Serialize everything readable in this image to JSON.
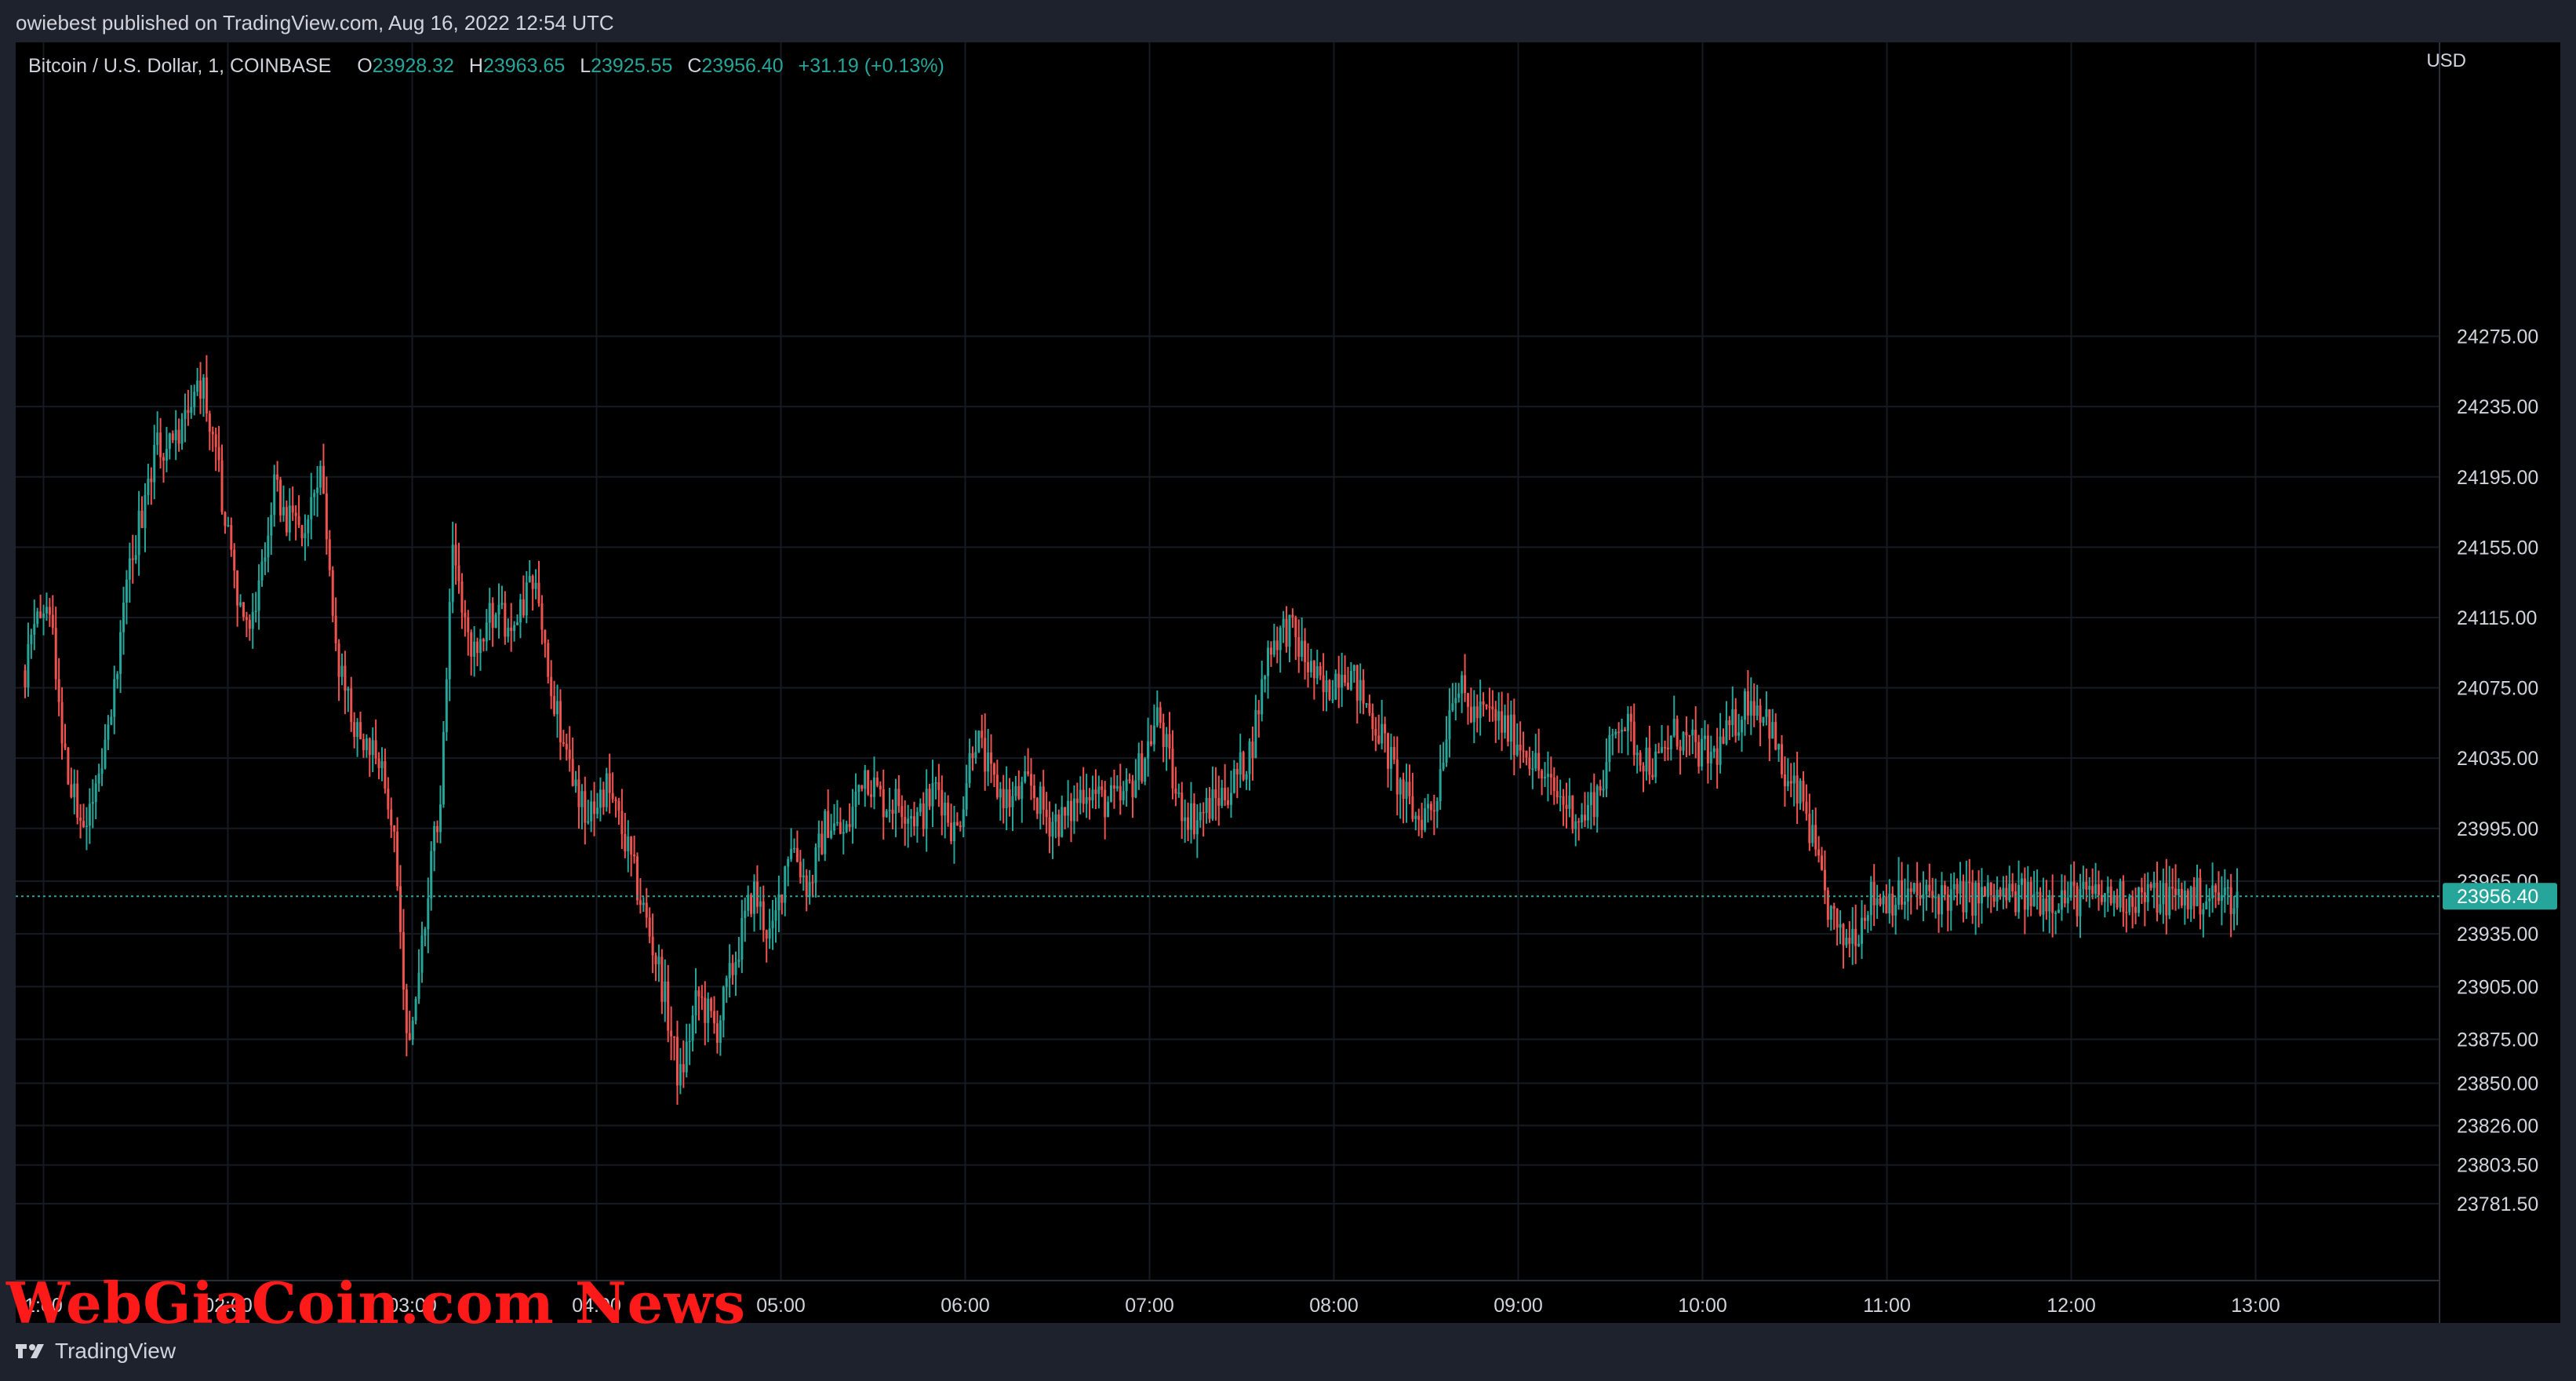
{
  "header": {
    "published_line": "owiebest published on TradingView.com, Aug 16, 2022 12:54 UTC"
  },
  "legend": {
    "symbol": "Bitcoin / U.S. Dollar, 1, COINBASE",
    "open_label": "O",
    "open": "23928.32",
    "high_label": "H",
    "high": "23963.65",
    "low_label": "L",
    "low": "23925.55",
    "close_label": "C",
    "close": "23956.40",
    "change": "+31.19 (+0.13%)"
  },
  "footer": {
    "brand": "TradingView",
    "watermark": "WebGiaCoin.com News"
  },
  "colors": {
    "up": "#26a69a",
    "down": "#ef5350",
    "grid": "#161a22",
    "axis_text": "#d1d4dc",
    "last_price_bg": "#26a69a"
  },
  "chart_data": {
    "type": "candlestick",
    "title": "Bitcoin / U.S. Dollar, 1, COINBASE",
    "currency": "USD",
    "x_ticks": [
      "1:00",
      "02:00",
      "03:00",
      "04:00",
      "05:00",
      "06:00",
      "07:00",
      "08:00",
      "09:00",
      "10:00",
      "11:00",
      "12:00",
      "13:00"
    ],
    "y_ticks": [
      "24275.00",
      "24235.00",
      "24195.00",
      "24155.00",
      "24115.00",
      "24075.00",
      "24035.00",
      "23995.00",
      "23965.00",
      "23935.00",
      "23905.00",
      "23875.00",
      "23850.00",
      "23826.00",
      "23803.50",
      "23781.50"
    ],
    "last_price": "23956.40",
    "start_hour": 0.9,
    "end_hour": 12.9,
    "keyframes": [
      [
        0.9,
        24085
      ],
      [
        1.02,
        24130
      ],
      [
        1.12,
        24030
      ],
      [
        1.22,
        23990
      ],
      [
        1.32,
        24030
      ],
      [
        1.45,
        24130
      ],
      [
        1.6,
        24210
      ],
      [
        1.75,
        24220
      ],
      [
        1.85,
        24250
      ],
      [
        1.95,
        24200
      ],
      [
        2.05,
        24120
      ],
      [
        2.12,
        24100
      ],
      [
        2.25,
        24190
      ],
      [
        2.38,
        24160
      ],
      [
        2.5,
        24200
      ],
      [
        2.6,
        24090
      ],
      [
        2.7,
        24050
      ],
      [
        2.8,
        24040
      ],
      [
        2.9,
        24000
      ],
      [
        2.98,
        23870
      ],
      [
        3.05,
        23930
      ],
      [
        3.15,
        24010
      ],
      [
        3.22,
        24160
      ],
      [
        3.32,
        24090
      ],
      [
        3.45,
        24120
      ],
      [
        3.55,
        24100
      ],
      [
        3.65,
        24140
      ],
      [
        3.75,
        24080
      ],
      [
        3.85,
        24030
      ],
      [
        3.95,
        24000
      ],
      [
        4.05,
        24020
      ],
      [
        4.15,
        23990
      ],
      [
        4.25,
        23950
      ],
      [
        4.35,
        23910
      ],
      [
        4.45,
        23850
      ],
      [
        4.55,
        23900
      ],
      [
        4.65,
        23880
      ],
      [
        4.75,
        23920
      ],
      [
        4.85,
        23960
      ],
      [
        4.95,
        23930
      ],
      [
        5.05,
        23990
      ],
      [
        5.15,
        23960
      ],
      [
        5.25,
        24000
      ],
      [
        5.35,
        23990
      ],
      [
        5.45,
        24030
      ],
      [
        5.55,
        24010
      ],
      [
        5.65,
        24010
      ],
      [
        5.75,
        24000
      ],
      [
        5.85,
        24020
      ],
      [
        5.95,
        23990
      ],
      [
        6.05,
        24050
      ],
      [
        6.15,
        24020
      ],
      [
        6.25,
        24010
      ],
      [
        6.35,
        24020
      ],
      [
        6.45,
        24000
      ],
      [
        6.55,
        24000
      ],
      [
        6.65,
        24020
      ],
      [
        6.75,
        24010
      ],
      [
        6.85,
        24010
      ],
      [
        6.95,
        24030
      ],
      [
        7.05,
        24060
      ],
      [
        7.15,
        24010
      ],
      [
        7.25,
        24000
      ],
      [
        7.35,
        24010
      ],
      [
        7.45,
        24020
      ],
      [
        7.55,
        24040
      ],
      [
        7.65,
        24100
      ],
      [
        7.75,
        24110
      ],
      [
        7.85,
        24090
      ],
      [
        7.95,
        24070
      ],
      [
        8.05,
        24090
      ],
      [
        8.15,
        24070
      ],
      [
        8.25,
        24050
      ],
      [
        8.35,
        24020
      ],
      [
        8.45,
        24000
      ],
      [
        8.55,
        24010
      ],
      [
        8.65,
        24080
      ],
      [
        8.75,
        24060
      ],
      [
        8.85,
        24060
      ],
      [
        8.95,
        24050
      ],
      [
        9.05,
        24040
      ],
      [
        9.15,
        24020
      ],
      [
        9.25,
        24010
      ],
      [
        9.35,
        24000
      ],
      [
        9.45,
        24020
      ],
      [
        9.55,
        24060
      ],
      [
        9.65,
        24040
      ],
      [
        9.75,
        24030
      ],
      [
        9.85,
        24050
      ],
      [
        9.95,
        24040
      ],
      [
        10.05,
        24035
      ],
      [
        10.15,
        24050
      ],
      [
        10.25,
        24070
      ],
      [
        10.35,
        24060
      ],
      [
        10.45,
        24020
      ],
      [
        10.55,
        24010
      ],
      [
        10.65,
        23960
      ],
      [
        10.75,
        23930
      ],
      [
        10.85,
        23940
      ],
      [
        10.9,
        23956
      ]
    ]
  }
}
